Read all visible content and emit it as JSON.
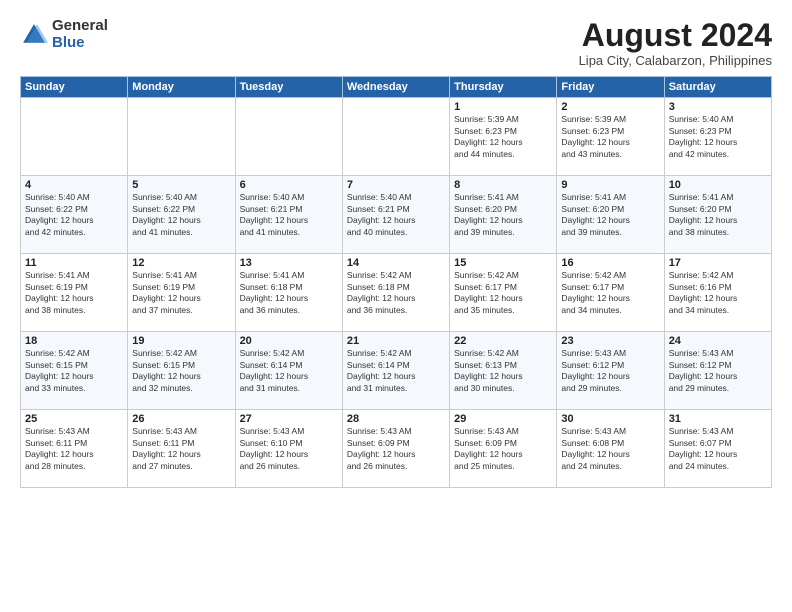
{
  "header": {
    "logo_general": "General",
    "logo_blue": "Blue",
    "title": "August 2024",
    "location": "Lipa City, Calabarzon, Philippines"
  },
  "days_of_week": [
    "Sunday",
    "Monday",
    "Tuesday",
    "Wednesday",
    "Thursday",
    "Friday",
    "Saturday"
  ],
  "weeks": [
    [
      {
        "day": "",
        "info": ""
      },
      {
        "day": "",
        "info": ""
      },
      {
        "day": "",
        "info": ""
      },
      {
        "day": "",
        "info": ""
      },
      {
        "day": "1",
        "info": "Sunrise: 5:39 AM\nSunset: 6:23 PM\nDaylight: 12 hours\nand 44 minutes."
      },
      {
        "day": "2",
        "info": "Sunrise: 5:39 AM\nSunset: 6:23 PM\nDaylight: 12 hours\nand 43 minutes."
      },
      {
        "day": "3",
        "info": "Sunrise: 5:40 AM\nSunset: 6:23 PM\nDaylight: 12 hours\nand 42 minutes."
      }
    ],
    [
      {
        "day": "4",
        "info": "Sunrise: 5:40 AM\nSunset: 6:22 PM\nDaylight: 12 hours\nand 42 minutes."
      },
      {
        "day": "5",
        "info": "Sunrise: 5:40 AM\nSunset: 6:22 PM\nDaylight: 12 hours\nand 41 minutes."
      },
      {
        "day": "6",
        "info": "Sunrise: 5:40 AM\nSunset: 6:21 PM\nDaylight: 12 hours\nand 41 minutes."
      },
      {
        "day": "7",
        "info": "Sunrise: 5:40 AM\nSunset: 6:21 PM\nDaylight: 12 hours\nand 40 minutes."
      },
      {
        "day": "8",
        "info": "Sunrise: 5:41 AM\nSunset: 6:20 PM\nDaylight: 12 hours\nand 39 minutes."
      },
      {
        "day": "9",
        "info": "Sunrise: 5:41 AM\nSunset: 6:20 PM\nDaylight: 12 hours\nand 39 minutes."
      },
      {
        "day": "10",
        "info": "Sunrise: 5:41 AM\nSunset: 6:20 PM\nDaylight: 12 hours\nand 38 minutes."
      }
    ],
    [
      {
        "day": "11",
        "info": "Sunrise: 5:41 AM\nSunset: 6:19 PM\nDaylight: 12 hours\nand 38 minutes."
      },
      {
        "day": "12",
        "info": "Sunrise: 5:41 AM\nSunset: 6:19 PM\nDaylight: 12 hours\nand 37 minutes."
      },
      {
        "day": "13",
        "info": "Sunrise: 5:41 AM\nSunset: 6:18 PM\nDaylight: 12 hours\nand 36 minutes."
      },
      {
        "day": "14",
        "info": "Sunrise: 5:42 AM\nSunset: 6:18 PM\nDaylight: 12 hours\nand 36 minutes."
      },
      {
        "day": "15",
        "info": "Sunrise: 5:42 AM\nSunset: 6:17 PM\nDaylight: 12 hours\nand 35 minutes."
      },
      {
        "day": "16",
        "info": "Sunrise: 5:42 AM\nSunset: 6:17 PM\nDaylight: 12 hours\nand 34 minutes."
      },
      {
        "day": "17",
        "info": "Sunrise: 5:42 AM\nSunset: 6:16 PM\nDaylight: 12 hours\nand 34 minutes."
      }
    ],
    [
      {
        "day": "18",
        "info": "Sunrise: 5:42 AM\nSunset: 6:15 PM\nDaylight: 12 hours\nand 33 minutes."
      },
      {
        "day": "19",
        "info": "Sunrise: 5:42 AM\nSunset: 6:15 PM\nDaylight: 12 hours\nand 32 minutes."
      },
      {
        "day": "20",
        "info": "Sunrise: 5:42 AM\nSunset: 6:14 PM\nDaylight: 12 hours\nand 31 minutes."
      },
      {
        "day": "21",
        "info": "Sunrise: 5:42 AM\nSunset: 6:14 PM\nDaylight: 12 hours\nand 31 minutes."
      },
      {
        "day": "22",
        "info": "Sunrise: 5:42 AM\nSunset: 6:13 PM\nDaylight: 12 hours\nand 30 minutes."
      },
      {
        "day": "23",
        "info": "Sunrise: 5:43 AM\nSunset: 6:12 PM\nDaylight: 12 hours\nand 29 minutes."
      },
      {
        "day": "24",
        "info": "Sunrise: 5:43 AM\nSunset: 6:12 PM\nDaylight: 12 hours\nand 29 minutes."
      }
    ],
    [
      {
        "day": "25",
        "info": "Sunrise: 5:43 AM\nSunset: 6:11 PM\nDaylight: 12 hours\nand 28 minutes."
      },
      {
        "day": "26",
        "info": "Sunrise: 5:43 AM\nSunset: 6:11 PM\nDaylight: 12 hours\nand 27 minutes."
      },
      {
        "day": "27",
        "info": "Sunrise: 5:43 AM\nSunset: 6:10 PM\nDaylight: 12 hours\nand 26 minutes."
      },
      {
        "day": "28",
        "info": "Sunrise: 5:43 AM\nSunset: 6:09 PM\nDaylight: 12 hours\nand 26 minutes."
      },
      {
        "day": "29",
        "info": "Sunrise: 5:43 AM\nSunset: 6:09 PM\nDaylight: 12 hours\nand 25 minutes."
      },
      {
        "day": "30",
        "info": "Sunrise: 5:43 AM\nSunset: 6:08 PM\nDaylight: 12 hours\nand 24 minutes."
      },
      {
        "day": "31",
        "info": "Sunrise: 5:43 AM\nSunset: 6:07 PM\nDaylight: 12 hours\nand 24 minutes."
      }
    ]
  ]
}
